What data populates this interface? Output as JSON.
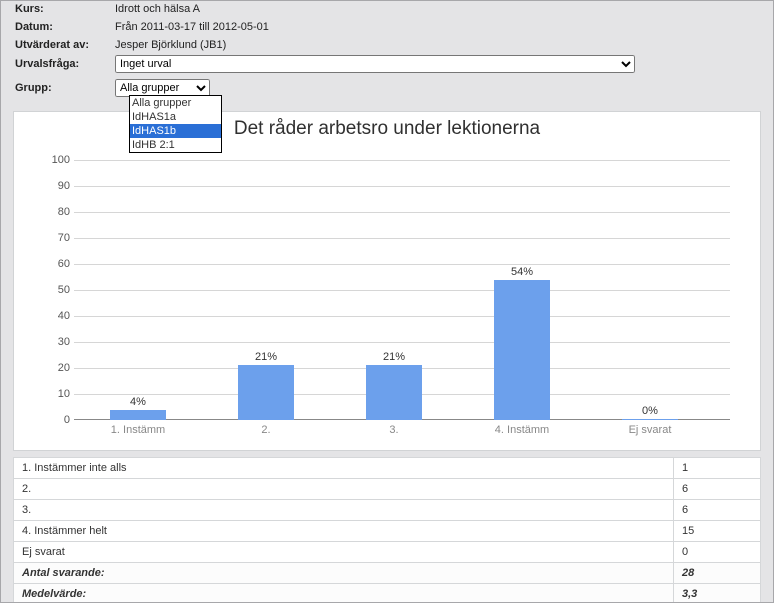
{
  "form": {
    "kurs_label": "Kurs:",
    "kurs_value": "Idrott och hälsa A",
    "datum_label": "Datum:",
    "datum_value": "Från 2011-03-17 till 2012-05-01",
    "utv_label": "Utvärderat av:",
    "utv_value": "Jesper Björklund (JB1)",
    "urval_label": "Urvalsfråga:",
    "urval_selected": "Inget urval",
    "grupp_label": "Grupp:",
    "grupp_selected": "Alla grupper",
    "grupp_options": [
      "Alla grupper",
      "IdHAS1a",
      "IdHAS1b",
      "IdHB 2:1"
    ],
    "grupp_highlight_index": 2
  },
  "chart_data": {
    "type": "bar",
    "title": "Det råder arbetsro under lektionerna",
    "categories": [
      "1. Instämm",
      "2.",
      "3.",
      "4. Instämm",
      "Ej svarat"
    ],
    "values": [
      4,
      21,
      21,
      54,
      0
    ],
    "value_labels": [
      "4%",
      "21%",
      "21%",
      "54%",
      "0%"
    ],
    "xlabel": "",
    "ylabel": "",
    "ylim": [
      0,
      100
    ],
    "yticks": [
      0,
      10,
      20,
      30,
      40,
      50,
      60,
      70,
      80,
      90,
      100
    ]
  },
  "results": {
    "rows": [
      {
        "label": "1. Instämmer inte alls",
        "value": "1"
      },
      {
        "label": "2.",
        "value": "6"
      },
      {
        "label": "3.",
        "value": "6"
      },
      {
        "label": "4. Instämmer helt",
        "value": "15"
      },
      {
        "label": "Ej svarat",
        "value": "0"
      }
    ],
    "total_label": "Antal svarande:",
    "total_value": "28",
    "mean_label": "Medelvärde:",
    "mean_value": "3,3"
  }
}
